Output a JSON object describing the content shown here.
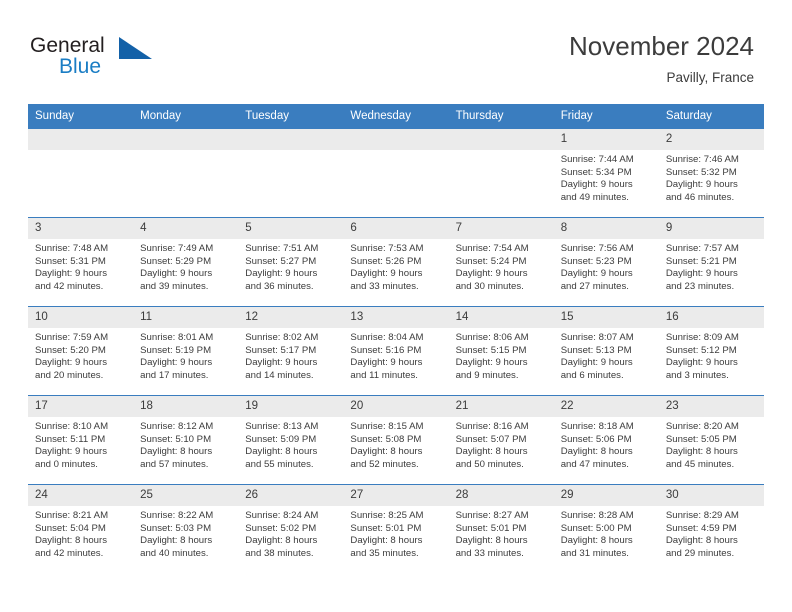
{
  "logo": {
    "text_top": "General",
    "text_bottom": "Blue",
    "icon": "triangle-mark",
    "color_blue": "#1a7dc4",
    "color_dark": "#231f20"
  },
  "header": {
    "title": "November 2024",
    "subtitle": "Pavilly, France"
  },
  "theme": {
    "header_blue": "#3a7dbf",
    "daynum_gray": "#ebebeb",
    "text": "#3c3c3c"
  },
  "calendar": {
    "weekday_headers": [
      "Sunday",
      "Monday",
      "Tuesday",
      "Wednesday",
      "Thursday",
      "Friday",
      "Saturday"
    ],
    "weeks": [
      [
        {
          "day": "",
          "lines": [
            "",
            "",
            "",
            ""
          ]
        },
        {
          "day": "",
          "lines": [
            "",
            "",
            "",
            ""
          ]
        },
        {
          "day": "",
          "lines": [
            "",
            "",
            "",
            ""
          ]
        },
        {
          "day": "",
          "lines": [
            "",
            "",
            "",
            ""
          ]
        },
        {
          "day": "",
          "lines": [
            "",
            "",
            "",
            ""
          ]
        },
        {
          "day": "1",
          "lines": [
            "Sunrise: 7:44 AM",
            "Sunset: 5:34 PM",
            "Daylight: 9 hours",
            "and 49 minutes."
          ]
        },
        {
          "day": "2",
          "lines": [
            "Sunrise: 7:46 AM",
            "Sunset: 5:32 PM",
            "Daylight: 9 hours",
            "and 46 minutes."
          ]
        }
      ],
      [
        {
          "day": "3",
          "lines": [
            "Sunrise: 7:48 AM",
            "Sunset: 5:31 PM",
            "Daylight: 9 hours",
            "and 42 minutes."
          ]
        },
        {
          "day": "4",
          "lines": [
            "Sunrise: 7:49 AM",
            "Sunset: 5:29 PM",
            "Daylight: 9 hours",
            "and 39 minutes."
          ]
        },
        {
          "day": "5",
          "lines": [
            "Sunrise: 7:51 AM",
            "Sunset: 5:27 PM",
            "Daylight: 9 hours",
            "and 36 minutes."
          ]
        },
        {
          "day": "6",
          "lines": [
            "Sunrise: 7:53 AM",
            "Sunset: 5:26 PM",
            "Daylight: 9 hours",
            "and 33 minutes."
          ]
        },
        {
          "day": "7",
          "lines": [
            "Sunrise: 7:54 AM",
            "Sunset: 5:24 PM",
            "Daylight: 9 hours",
            "and 30 minutes."
          ]
        },
        {
          "day": "8",
          "lines": [
            "Sunrise: 7:56 AM",
            "Sunset: 5:23 PM",
            "Daylight: 9 hours",
            "and 27 minutes."
          ]
        },
        {
          "day": "9",
          "lines": [
            "Sunrise: 7:57 AM",
            "Sunset: 5:21 PM",
            "Daylight: 9 hours",
            "and 23 minutes."
          ]
        }
      ],
      [
        {
          "day": "10",
          "lines": [
            "Sunrise: 7:59 AM",
            "Sunset: 5:20 PM",
            "Daylight: 9 hours",
            "and 20 minutes."
          ]
        },
        {
          "day": "11",
          "lines": [
            "Sunrise: 8:01 AM",
            "Sunset: 5:19 PM",
            "Daylight: 9 hours",
            "and 17 minutes."
          ]
        },
        {
          "day": "12",
          "lines": [
            "Sunrise: 8:02 AM",
            "Sunset: 5:17 PM",
            "Daylight: 9 hours",
            "and 14 minutes."
          ]
        },
        {
          "day": "13",
          "lines": [
            "Sunrise: 8:04 AM",
            "Sunset: 5:16 PM",
            "Daylight: 9 hours",
            "and 11 minutes."
          ]
        },
        {
          "day": "14",
          "lines": [
            "Sunrise: 8:06 AM",
            "Sunset: 5:15 PM",
            "Daylight: 9 hours",
            "and 9 minutes."
          ]
        },
        {
          "day": "15",
          "lines": [
            "Sunrise: 8:07 AM",
            "Sunset: 5:13 PM",
            "Daylight: 9 hours",
            "and 6 minutes."
          ]
        },
        {
          "day": "16",
          "lines": [
            "Sunrise: 8:09 AM",
            "Sunset: 5:12 PM",
            "Daylight: 9 hours",
            "and 3 minutes."
          ]
        }
      ],
      [
        {
          "day": "17",
          "lines": [
            "Sunrise: 8:10 AM",
            "Sunset: 5:11 PM",
            "Daylight: 9 hours",
            "and 0 minutes."
          ]
        },
        {
          "day": "18",
          "lines": [
            "Sunrise: 8:12 AM",
            "Sunset: 5:10 PM",
            "Daylight: 8 hours",
            "and 57 minutes."
          ]
        },
        {
          "day": "19",
          "lines": [
            "Sunrise: 8:13 AM",
            "Sunset: 5:09 PM",
            "Daylight: 8 hours",
            "and 55 minutes."
          ]
        },
        {
          "day": "20",
          "lines": [
            "Sunrise: 8:15 AM",
            "Sunset: 5:08 PM",
            "Daylight: 8 hours",
            "and 52 minutes."
          ]
        },
        {
          "day": "21",
          "lines": [
            "Sunrise: 8:16 AM",
            "Sunset: 5:07 PM",
            "Daylight: 8 hours",
            "and 50 minutes."
          ]
        },
        {
          "day": "22",
          "lines": [
            "Sunrise: 8:18 AM",
            "Sunset: 5:06 PM",
            "Daylight: 8 hours",
            "and 47 minutes."
          ]
        },
        {
          "day": "23",
          "lines": [
            "Sunrise: 8:20 AM",
            "Sunset: 5:05 PM",
            "Daylight: 8 hours",
            "and 45 minutes."
          ]
        }
      ],
      [
        {
          "day": "24",
          "lines": [
            "Sunrise: 8:21 AM",
            "Sunset: 5:04 PM",
            "Daylight: 8 hours",
            "and 42 minutes."
          ]
        },
        {
          "day": "25",
          "lines": [
            "Sunrise: 8:22 AM",
            "Sunset: 5:03 PM",
            "Daylight: 8 hours",
            "and 40 minutes."
          ]
        },
        {
          "day": "26",
          "lines": [
            "Sunrise: 8:24 AM",
            "Sunset: 5:02 PM",
            "Daylight: 8 hours",
            "and 38 minutes."
          ]
        },
        {
          "day": "27",
          "lines": [
            "Sunrise: 8:25 AM",
            "Sunset: 5:01 PM",
            "Daylight: 8 hours",
            "and 35 minutes."
          ]
        },
        {
          "day": "28",
          "lines": [
            "Sunrise: 8:27 AM",
            "Sunset: 5:01 PM",
            "Daylight: 8 hours",
            "and 33 minutes."
          ]
        },
        {
          "day": "29",
          "lines": [
            "Sunrise: 8:28 AM",
            "Sunset: 5:00 PM",
            "Daylight: 8 hours",
            "and 31 minutes."
          ]
        },
        {
          "day": "30",
          "lines": [
            "Sunrise: 8:29 AM",
            "Sunset: 4:59 PM",
            "Daylight: 8 hours",
            "and 29 minutes."
          ]
        }
      ]
    ]
  }
}
